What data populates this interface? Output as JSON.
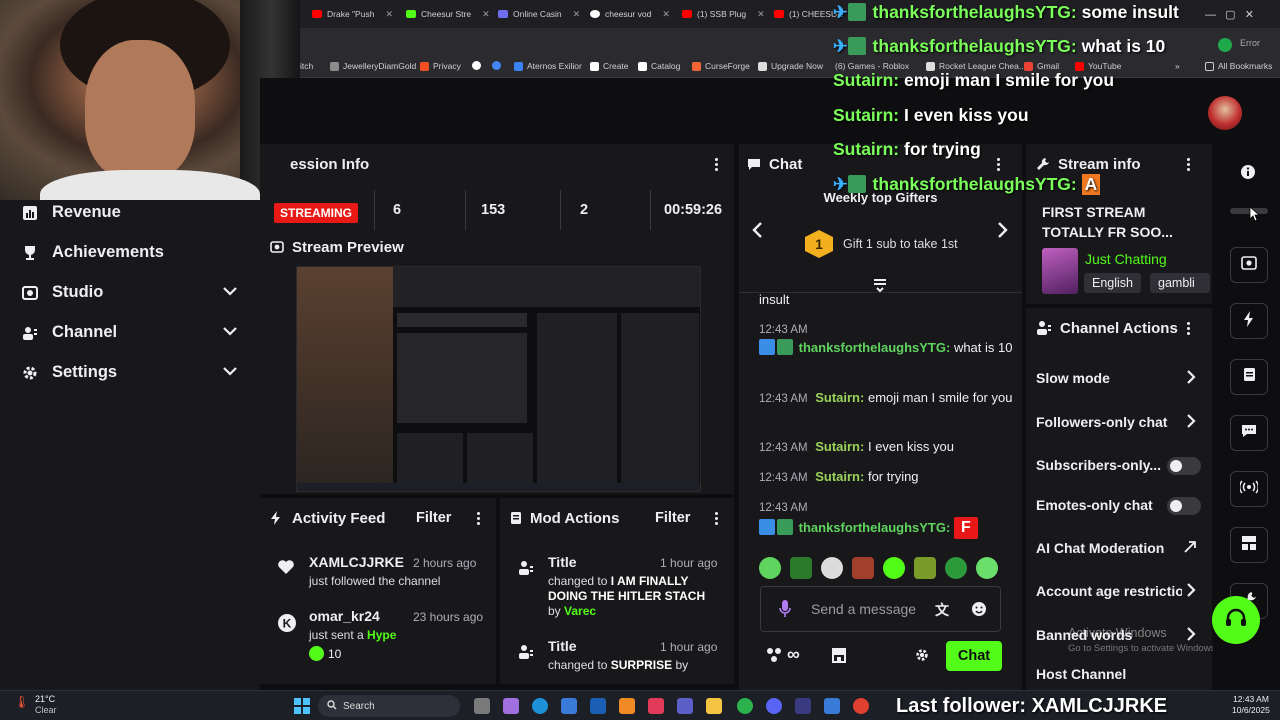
{
  "browser": {
    "tabs": [
      {
        "label": "Drake \"Push",
        "color": "#ff0000"
      },
      {
        "label": "Cheesur Stre",
        "color": "#53fc18"
      },
      {
        "label": "Online Casin",
        "color": "#6e6ef0"
      },
      {
        "label": "cheesur vod",
        "color": "#ffffff"
      },
      {
        "label": "(1) SSB Plug",
        "color": "#ff0000"
      },
      {
        "label": "(1) CHEESUR",
        "color": "#ff0000"
      }
    ],
    "address_right": "Error",
    "bookmarks": [
      {
        "label": "itch",
        "color": "#ff4a4a"
      },
      {
        "label": "JewelleryDiamGold",
        "color": "#8c8c8c"
      },
      {
        "label": "Privacy",
        "color": "#f25022"
      },
      {
        "label": "",
        "color": "#ffffff"
      },
      {
        "label": "",
        "color": "#4285f4"
      },
      {
        "label": "Aternos Exilior",
        "color": "#3b82f6"
      },
      {
        "label": "Create",
        "color": "#ffffff"
      },
      {
        "label": "Catalog",
        "color": "#ffffff"
      },
      {
        "label": "CurseForge",
        "color": "#f16436"
      },
      {
        "label": "Upgrade Now",
        "color": "#dddddd"
      },
      {
        "label": "(6) Games - Roblox",
        "color": "#dddddd"
      },
      {
        "label": "Rocket League Chea...",
        "color": "#dddddd"
      },
      {
        "label": "Gmail",
        "color": "#ea4335"
      },
      {
        "label": "YouTube",
        "color": "#ff0000"
      }
    ],
    "all_bookmarks": "All Bookmarks"
  },
  "nav": {
    "items": [
      {
        "label": "Revenue",
        "icon": "revenue-icon",
        "expandable": false
      },
      {
        "label": "Achievements",
        "icon": "trophy-icon",
        "expandable": false
      },
      {
        "label": "Studio",
        "icon": "studio-icon",
        "expandable": true
      },
      {
        "label": "Channel",
        "icon": "channel-icon",
        "expandable": true
      },
      {
        "label": "Settings",
        "icon": "gear-icon",
        "expandable": true
      }
    ]
  },
  "session": {
    "title": "ession Info",
    "status": "STREAMING",
    "stats": [
      "6",
      "153",
      "2",
      "00:59:26"
    ]
  },
  "preview": {
    "title": "Stream Preview"
  },
  "activity": {
    "title": "Activity Feed",
    "filter": "Filter",
    "items": [
      {
        "name": "XAMLCJJRKE",
        "time": "2 hours ago",
        "text": "just followed the channel"
      },
      {
        "name": "omar_kr24",
        "time": "23 hours ago",
        "text": "just sent a",
        "highlight": "Hype",
        "amount": "10"
      }
    ]
  },
  "modactions": {
    "title": "Mod Actions",
    "filter": "Filter",
    "items": [
      {
        "title": "Title",
        "time": "1 hour ago",
        "changed_to": "changed to",
        "value": "I AM FINALLY DOING THE HITLER STACH",
        "by": "by",
        "who": "Varec"
      },
      {
        "title": "Title",
        "time": "1 hour ago",
        "changed_to": "changed to",
        "value": "SURPRISE",
        "by": "by"
      }
    ]
  },
  "chat": {
    "title": "Chat",
    "gifters_title": "Weekly top Gifters",
    "gift_rank": "1",
    "gift_cta": "Gift 1 sub to take 1st",
    "messages": [
      {
        "time": "",
        "user": "",
        "text": "insult"
      },
      {
        "time": "12:43 AM",
        "user": "thanksforthelaughsYTG:",
        "text": "what is 10"
      },
      {
        "time": "12:43 AM",
        "user": "Sutairn:",
        "text": "emoji man I smile for you"
      },
      {
        "time": "12:43 AM",
        "user": "Sutairn:",
        "text": "I even kiss you"
      },
      {
        "time": "12:43 AM",
        "user": "Sutairn:",
        "text": "for trying"
      },
      {
        "time": "12:43 AM",
        "user": "thanksforthelaughsYTG:",
        "text": "F"
      }
    ],
    "input_placeholder": "Send a message",
    "send_label": "Chat"
  },
  "streaminfo": {
    "title": "Stream info",
    "stream_title": "FIRST STREAM TOTALLY FR SOO...",
    "category": "Just Chatting",
    "tags": [
      "English",
      "gambli"
    ]
  },
  "channelactions": {
    "title": "Channel Actions",
    "items": [
      {
        "label": "Slow mode",
        "control": "chevron"
      },
      {
        "label": "Followers-only chat",
        "control": "chevron"
      },
      {
        "label": "Subscribers-only...",
        "control": "toggle"
      },
      {
        "label": "Emotes-only chat",
        "control": "toggle"
      },
      {
        "label": "AI Chat Moderation",
        "control": "external"
      },
      {
        "label": "Account age restrictio",
        "control": "chevron"
      },
      {
        "label": "Banned words",
        "control": "chevron"
      },
      {
        "label": "Host Channel",
        "control": "none"
      }
    ]
  },
  "overlay": {
    "lines": [
      {
        "user": "thanksforthelaughsYTG:",
        "text": "some insult"
      },
      {
        "user": "thanksforthelaughsYTG:",
        "text": "what is 10"
      },
      {
        "user": "Sutairn:",
        "text": "emoji man I smile for you"
      },
      {
        "user": "Sutairn:",
        "text": "I even kiss you"
      },
      {
        "user": "Sutairn:",
        "text": "for trying"
      },
      {
        "user": "thanksforthelaughsYTG:",
        "text": "A"
      }
    ],
    "last_follower": "Last follower: XAMLCJJRKE",
    "watermark1": "Activate Windows",
    "watermark2": "Go to Settings to activate Windows."
  },
  "taskbar": {
    "weather_temp": "21°C",
    "weather_text": "Clear",
    "search": "Search",
    "time": "12:43 AM",
    "date": "10/6/2025"
  },
  "colors": {
    "accent_green": "#53fc18",
    "live_red": "#e91916",
    "panel_bg": "#18181b"
  }
}
